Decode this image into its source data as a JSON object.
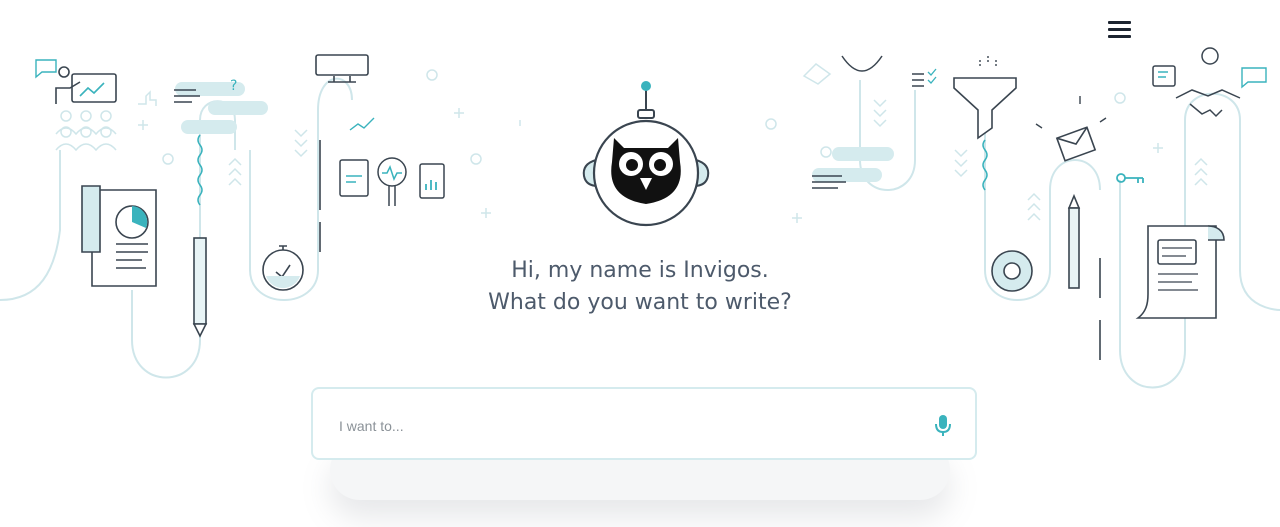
{
  "header": {
    "menu_icon": "hamburger-menu-icon"
  },
  "hero": {
    "logo_icon": "owl-robot-icon",
    "greeting_line1": "Hi, my name is Invigos.",
    "greeting_line2": "What do you want to write?"
  },
  "search": {
    "placeholder": "I want to...",
    "value": "",
    "mic_icon": "microphone-icon"
  },
  "colors": {
    "accent": "#3ab3bd",
    "line": "#cfe6ea",
    "dark": "#3a4550",
    "text": "#4d5a6b"
  }
}
